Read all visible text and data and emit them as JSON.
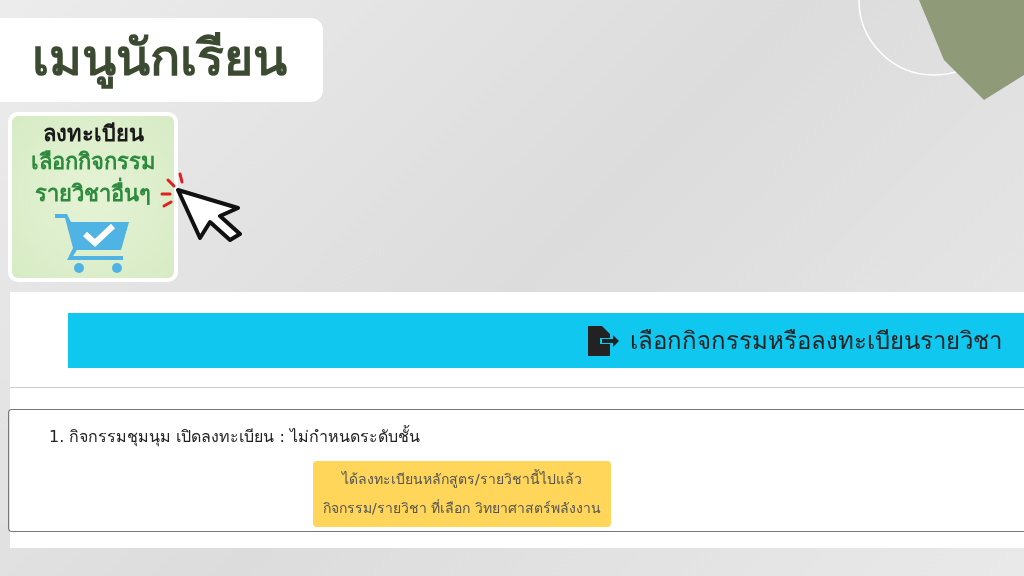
{
  "title": "เมนูนักเรียน",
  "menu_tile": {
    "lines": [
      "ลงทะเบียน",
      "เลือกกิจกรรม",
      "รายวิชาอื่นๆ"
    ]
  },
  "header_bar": {
    "title": "เลือกกิจกรรมหรือลงทะเบียนรายวิชา"
  },
  "items": [
    {
      "label": "1. กิจกรรมชุมนุม เปิดลงทะเบียน : ไม่กำหนดระดับชั้น",
      "notice": [
        "ได้ลงทะเบียนหลักสูตร/รายวิชานี้ไปแล้ว",
        "กิจกรรม/รายวิชา ที่เลือก วิทยาศาสตร์พลังงาน"
      ]
    }
  ]
}
